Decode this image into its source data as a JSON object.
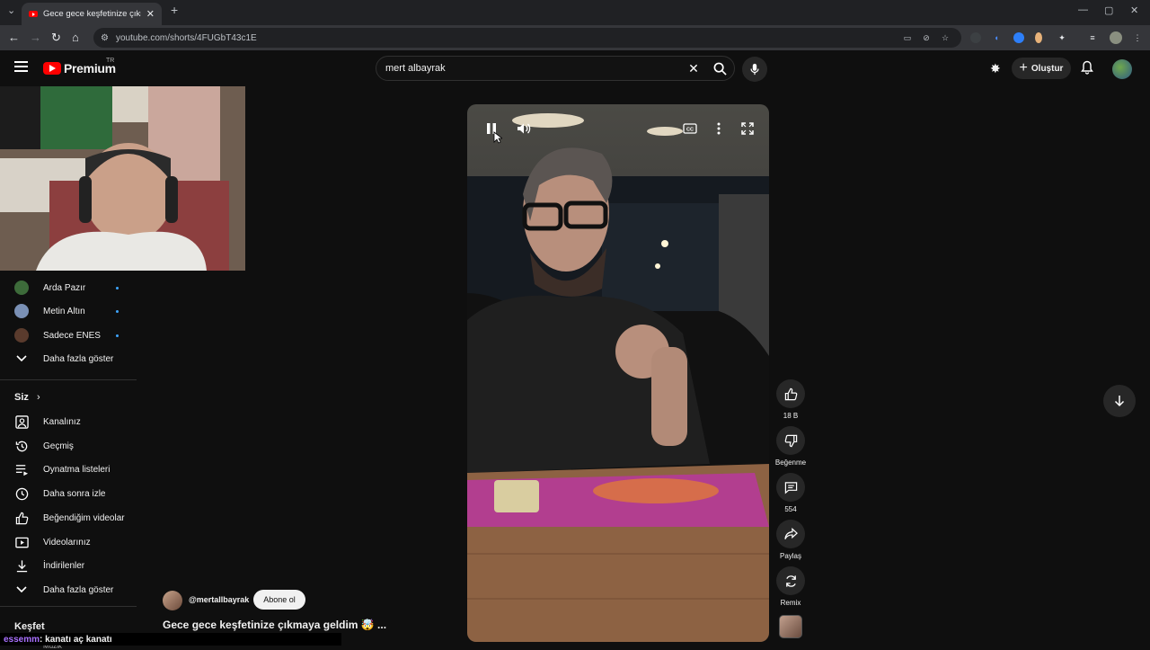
{
  "browser": {
    "tab_title": "Gece gece keşfetinize çıkmaya ...",
    "tab_close": "✕",
    "new_tab": "+",
    "url": "youtube.com/shorts/4FUGbT43c1E",
    "window_minimize": "—",
    "window_maximize": "▢",
    "window_close": "✕"
  },
  "header": {
    "logo_text": "Premium",
    "logo_region": "TR",
    "search_value": "mert albayrak",
    "create_label": "Oluştur"
  },
  "sidebar": {
    "subscriptions": [
      {
        "label": "Arda Pazır",
        "avatar_color": "#3d6b3a"
      },
      {
        "label": "Metin Altın",
        "avatar_color": "#7a90b5"
      },
      {
        "label": "Sadece ENES",
        "avatar_color": "#5a3b2d"
      }
    ],
    "show_more_subs": "Daha fazla göster",
    "you_section": "Siz",
    "you_items": [
      {
        "label": "Kanalınız",
        "icon": "channel-icon"
      },
      {
        "label": "Geçmiş",
        "icon": "history-icon"
      },
      {
        "label": "Oynatma listeleri",
        "icon": "playlists-icon"
      },
      {
        "label": "Daha sonra izle",
        "icon": "clock-icon"
      },
      {
        "label": "Beğendiğim videolar",
        "icon": "like-icon"
      },
      {
        "label": "Videolarınız",
        "icon": "your-videos-icon"
      },
      {
        "label": "İndirilenler",
        "icon": "download-icon"
      }
    ],
    "show_more_you": "Daha fazla göster",
    "explore_section": "Keşfet",
    "explore_first_item": "Müzik"
  },
  "actions": {
    "like_count": "18 B",
    "dislike_label": "Beğenme",
    "comments_count": "554",
    "share_label": "Paylaş",
    "remix_label": "Remix"
  },
  "channel": {
    "handle": "@mertallbayrak",
    "subscribe_label": "Abone ol"
  },
  "short": {
    "title": "Gece gece keşfetinize çıkmaya geldim 🤯 ..."
  },
  "chat": {
    "user": "essemm",
    "message": ": kanatı aç kanatı"
  },
  "colors": {
    "brand_red": "#ff0000",
    "background": "#0f0f0f",
    "button_bg": "#272727",
    "unread_dot": "#3ea6ff"
  }
}
